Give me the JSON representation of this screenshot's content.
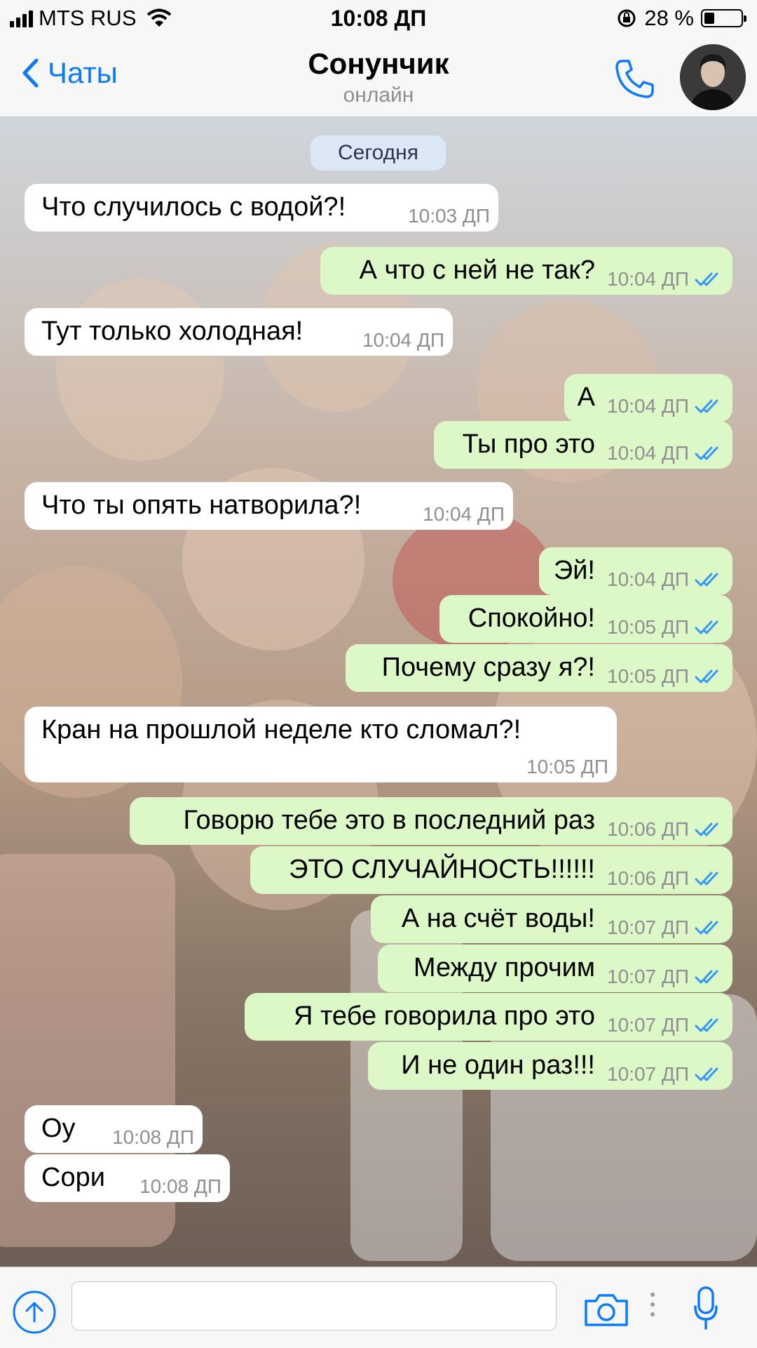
{
  "status_bar": {
    "carrier": "MTS RUS",
    "time": "10:08 ДП",
    "battery_percent": "28 %",
    "battery_level": 0.28
  },
  "header": {
    "back_label": "Чаты",
    "contact_name": "Сонунчик",
    "presence": "онлайн"
  },
  "chat": {
    "date_label": "Сегодня",
    "messages": [
      {
        "dir": "in",
        "text": "Что случилось с водой?!",
        "time": "10:03 ДП"
      },
      {
        "dir": "out",
        "text": "А что с ней не так?",
        "time": "10:04 ДП",
        "read": true
      },
      {
        "dir": "in",
        "text": "Тут только холодная!",
        "time": "10:04 ДП"
      },
      {
        "dir": "out",
        "text": "А",
        "time": "10:04 ДП",
        "read": true
      },
      {
        "dir": "out",
        "text": "Ты про это",
        "time": "10:04 ДП",
        "read": true
      },
      {
        "dir": "in",
        "text": "Что ты опять натворила?!",
        "time": "10:04 ДП"
      },
      {
        "dir": "out",
        "text": "Эй!",
        "time": "10:04 ДП",
        "read": true
      },
      {
        "dir": "out",
        "text": "Спокойно!",
        "time": "10:05 ДП",
        "read": true
      },
      {
        "dir": "out",
        "text": "Почему сразу я?!",
        "time": "10:05 ДП",
        "read": true
      },
      {
        "dir": "in",
        "text": "Кран на прошлой неделе кто сломал?!",
        "time": "10:05 ДП"
      },
      {
        "dir": "out",
        "text": "Говорю тебе это в последний раз",
        "time": "10:06 ДП",
        "read": true
      },
      {
        "dir": "out",
        "text": "ЭТО СЛУЧАЙНОСТЬ!!!!!!",
        "time": "10:06 ДП",
        "read": true
      },
      {
        "dir": "out",
        "text": "А на счёт воды!",
        "time": "10:07 ДП",
        "read": true
      },
      {
        "dir": "out",
        "text": "Между прочим",
        "time": "10:07 ДП",
        "read": true
      },
      {
        "dir": "out",
        "text": "Я тебе говорила про это",
        "time": "10:07 ДП",
        "read": true
      },
      {
        "dir": "out",
        "text": "И не один раз!!!",
        "time": "10:07 ДП",
        "read": true
      },
      {
        "dir": "in",
        "text": "Оу",
        "time": "10:08 ДП"
      },
      {
        "dir": "in",
        "text": "Сори",
        "time": "10:08 ДП"
      }
    ]
  },
  "input_bar": {
    "placeholder": "",
    "value": ""
  },
  "colors": {
    "accent": "#0a7aff",
    "outgoing_bubble": "#dcf8c6",
    "incoming_bubble": "#ffffff",
    "read_checks": "#3497f9",
    "date_pill": "#dde8f6"
  },
  "icons": [
    "signal-icon",
    "wifi-icon",
    "rotation-lock-icon",
    "battery-icon",
    "back-chevron-icon",
    "phone-icon",
    "attach-up-icon",
    "camera-icon",
    "more-dots-icon",
    "microphone-icon",
    "double-check-icon"
  ]
}
